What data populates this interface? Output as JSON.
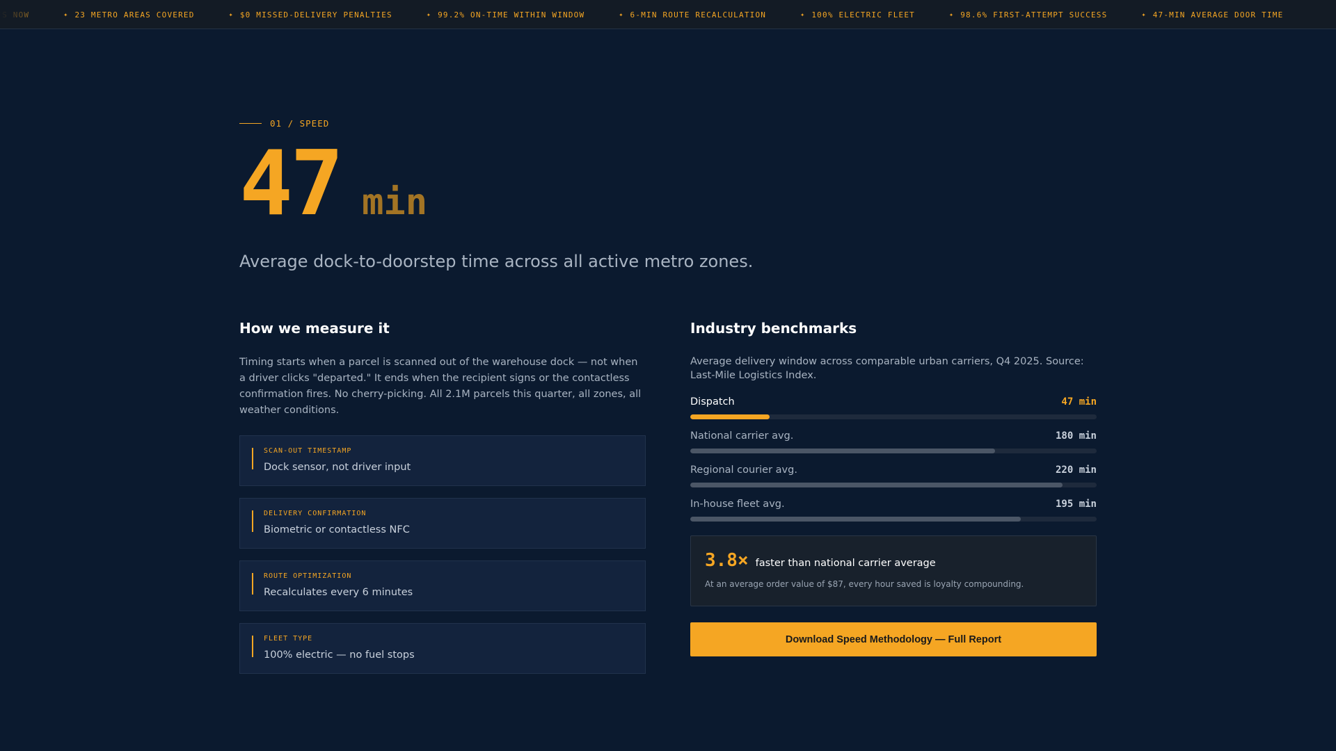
{
  "ticker": {
    "items": [
      "ROUTES NOW",
      "23 METRO AREAS COVERED",
      "$0 MISSED-DELIVERY PENALTIES",
      "99.2% ON-TIME WITHIN WINDOW",
      "6-MIN ROUTE RECALCULATION",
      "100% ELECTRIC FLEET",
      "98.6% FIRST-ATTEMPT SUCCESS",
      "47-MIN AVERAGE DOOR TIME"
    ],
    "separator": "✦"
  },
  "hero": {
    "eyebrow": "01 / SPEED",
    "number": "47",
    "unit": "min",
    "lede": "Average dock-to-doorstep time across all active metro zones."
  },
  "measure": {
    "title": "How we measure it",
    "body": "Timing starts when a parcel is scanned out of the warehouse dock — not when a driver clicks \"departed.\" It ends when the recipient signs or the contactless confirmation fires. No cherry-picking. All 2.1M parcels this quarter, all zones, all weather conditions.",
    "cards": [
      {
        "label": "SCAN-OUT TIMESTAMP",
        "value": "Dock sensor, not driver input"
      },
      {
        "label": "DELIVERY CONFIRMATION",
        "value": "Biometric or contactless NFC"
      },
      {
        "label": "ROUTE OPTIMIZATION",
        "value": "Recalculates every 6 minutes"
      },
      {
        "label": "FLEET TYPE",
        "value": "100% electric — no fuel stops"
      }
    ]
  },
  "benchmarks": {
    "title": "Industry benchmarks",
    "intro": "Average delivery window across comparable urban carriers, Q4 2025. Source: Last-Mile Logistics Index.",
    "scale_max": 240,
    "rows": [
      {
        "name": "Dispatch",
        "value": 47,
        "label": "47 min",
        "highlight": true
      },
      {
        "name": "National carrier avg.",
        "value": 180,
        "label": "180 min",
        "highlight": false
      },
      {
        "name": "Regional courier avg.",
        "value": 220,
        "label": "220 min",
        "highlight": false
      },
      {
        "name": "In-house fleet avg.",
        "value": 195,
        "label": "195 min",
        "highlight": false
      }
    ],
    "accent": "#f5a623",
    "bar_color": "#4b5666"
  },
  "compare": {
    "multiplier": "3.8×",
    "text": "faster than national carrier average",
    "note": "At an average order value of $87, every hour saved is loyalty compounding."
  },
  "cta": {
    "label": "Download Speed Methodology — Full Report"
  }
}
